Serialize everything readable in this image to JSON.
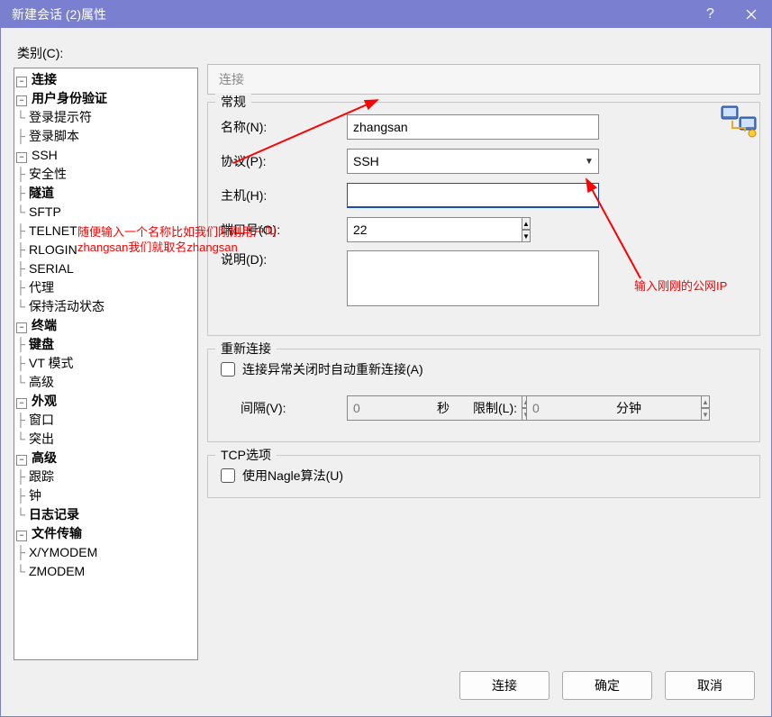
{
  "window": {
    "title": "新建会话 (2)属性"
  },
  "category_label": "类别(C):",
  "tree": {
    "connection": "连接",
    "user_auth": "用户身份验证",
    "login_prompt": "登录提示符",
    "login_script": "登录脚本",
    "ssh": "SSH",
    "security": "安全性",
    "tunnel": "隧道",
    "sftp": "SFTP",
    "telnet": "TELNET",
    "rlogin": "RLOGIN",
    "serial": "SERIAL",
    "proxy": "代理",
    "keepalive": "保持活动状态",
    "terminal": "终端",
    "keyboard": "键盘",
    "vt_mode": "VT 模式",
    "advanced_t": "高级",
    "appearance": "外观",
    "window": "窗口",
    "highlight": "突出",
    "advanced": "高级",
    "trace": "跟踪",
    "bell": "钟",
    "logging": "日志记录",
    "file_transfer": "文件传输",
    "xymodem": "X/YMODEM",
    "zmodem": "ZMODEM"
  },
  "breadcrumb": "连接",
  "groups": {
    "general": "常规",
    "reconnect": "重新连接",
    "tcp": "TCP选项"
  },
  "form": {
    "name_label": "名称(N):",
    "name_value": "zhangsan",
    "protocol_label": "协议(P):",
    "protocol_value": "SSH",
    "host_label": "主机(H):",
    "host_value": "",
    "port_label": "端口号(O):",
    "port_value": "22",
    "desc_label": "说明(D):",
    "desc_value": "",
    "reconnect_chk": "连接异常关闭时自动重新连接(A)",
    "interval_label": "间隔(V):",
    "interval_value": "0",
    "interval_unit": "秒",
    "limit_label": "限制(L):",
    "limit_value": "0",
    "limit_unit": "分钟",
    "nagle_chk": "使用Nagle算法(U)"
  },
  "annotations": {
    "name_tip": "随便输入一个名称比如我们刚刚用户叫zhangsan我们就取名zhangsan",
    "host_tip": "输入刚刚的公网IP"
  },
  "buttons": {
    "connect": "连接",
    "ok": "确定",
    "cancel": "取消"
  }
}
